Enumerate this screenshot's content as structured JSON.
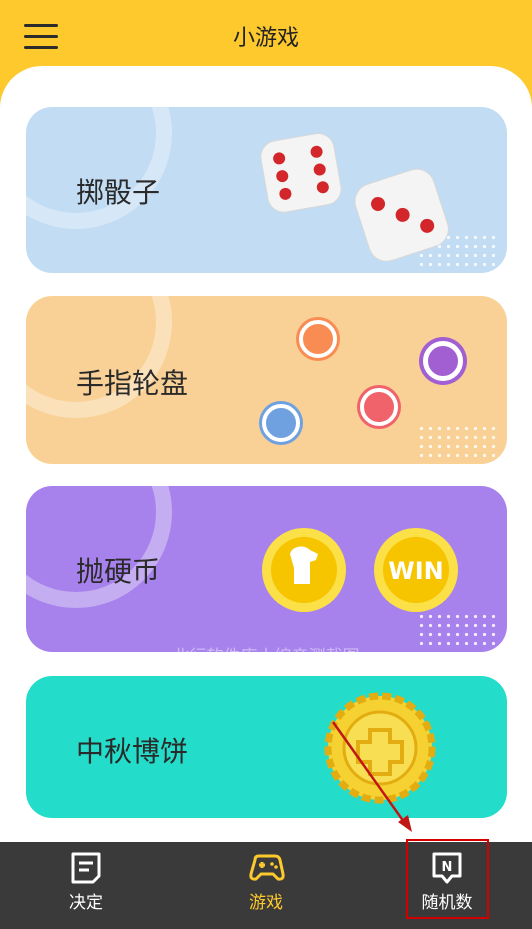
{
  "header": {
    "title": "小游戏",
    "menu_icon": "hamburger-menu-icon"
  },
  "cards": [
    {
      "label": "掷骰子",
      "color": "#c1dcf3",
      "icon": "dice-icon"
    },
    {
      "label": "手指轮盘",
      "color": "#f9d196",
      "icon": "finger-roulette-icon"
    },
    {
      "label": "抛硬币",
      "color": "#a781ec",
      "icon": "coin-icon",
      "coin_text": "WIN"
    },
    {
      "label": "中秋博饼",
      "color": "#23dcc9",
      "icon": "mooncake-icon"
    }
  ],
  "watermark": "北行软件库小编亲测截图",
  "nav": {
    "items": [
      {
        "label": "决定",
        "icon": "decide-icon",
        "active": false
      },
      {
        "label": "游戏",
        "icon": "gamepad-icon",
        "active": true
      },
      {
        "label": "随机数",
        "icon": "random-number-icon",
        "badge": "N",
        "active": false
      }
    ]
  },
  "colors": {
    "accent": "#fdc92c",
    "nav_bg": "#3a3a3a",
    "active": "#fdc92c",
    "highlight": "#d40000"
  }
}
